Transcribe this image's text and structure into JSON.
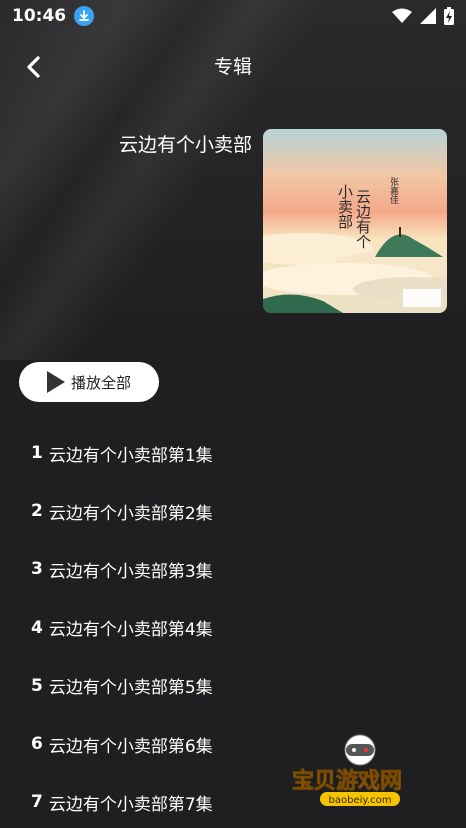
{
  "status_bar": {
    "time": "10:46",
    "icons": [
      "download-icon",
      "wifi-icon",
      "signal-icon",
      "battery-charging-icon"
    ]
  },
  "nav": {
    "title": "专辑",
    "back_icon": "chevron-left-icon"
  },
  "album": {
    "title": "云边有个小卖部",
    "cover": {
      "title_text": "云边有个小卖部",
      "author_text": "张嘉佳"
    }
  },
  "actions": {
    "play_all_label": "播放全部",
    "play_icon": "play-icon"
  },
  "episodes": [
    {
      "num": "1",
      "title": "云边有个小卖部第1集"
    },
    {
      "num": "2",
      "title": "云边有个小卖部第2集"
    },
    {
      "num": "3",
      "title": "云边有个小卖部第3集"
    },
    {
      "num": "4",
      "title": "云边有个小卖部第4集"
    },
    {
      "num": "5",
      "title": "云边有个小卖部第5集"
    },
    {
      "num": "6",
      "title": "云边有个小卖部第6集"
    },
    {
      "num": "7",
      "title": "云边有个小卖部第7集"
    }
  ],
  "watermark": {
    "name": "宝贝游戏网",
    "url": "baobeiy.com"
  },
  "colors": {
    "background": "#1f1f21",
    "text": "#ffffff",
    "button_bg": "#ffffff",
    "accent_blue": "#3aa3f5"
  }
}
